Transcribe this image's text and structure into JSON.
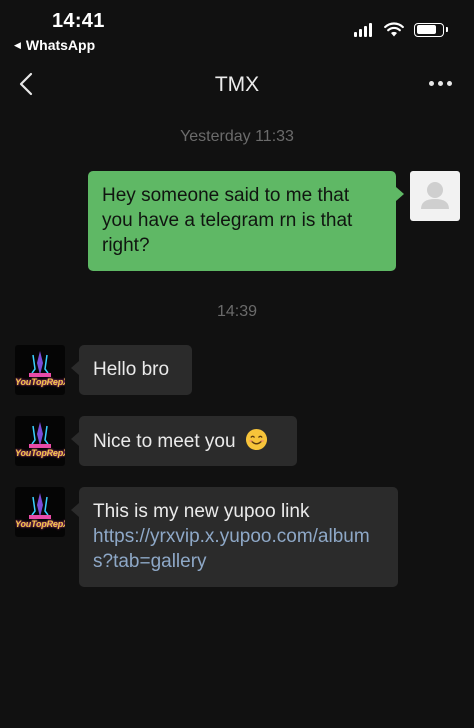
{
  "status_bar": {
    "time": "14:41",
    "back_app": "WhatsApp"
  },
  "header": {
    "title": "TMX"
  },
  "messages": [
    {
      "type": "timestamp",
      "text": "Yesterday 11:33"
    },
    {
      "type": "outgoing",
      "text": "Hey someone said to me that you have a telegram rn is that right?"
    },
    {
      "type": "timestamp",
      "text": "14:39"
    },
    {
      "type": "incoming",
      "text": "Hello bro"
    },
    {
      "type": "incoming",
      "text": "Nice to meet you",
      "emoji": "smiling-face-emoji"
    },
    {
      "type": "incoming",
      "text": "This is my new yupoo link",
      "link": "https://yrxvip.x.yupoo.com/albums?tab=gallery"
    }
  ],
  "contact_avatar": {
    "label": "YouTopRepX"
  },
  "colors": {
    "background": "#111111",
    "outgoing_bubble": "#5fb865",
    "incoming_bubble": "#2b2b2b",
    "link": "#8ea8c7",
    "timestamp": "#6b6b6b"
  }
}
